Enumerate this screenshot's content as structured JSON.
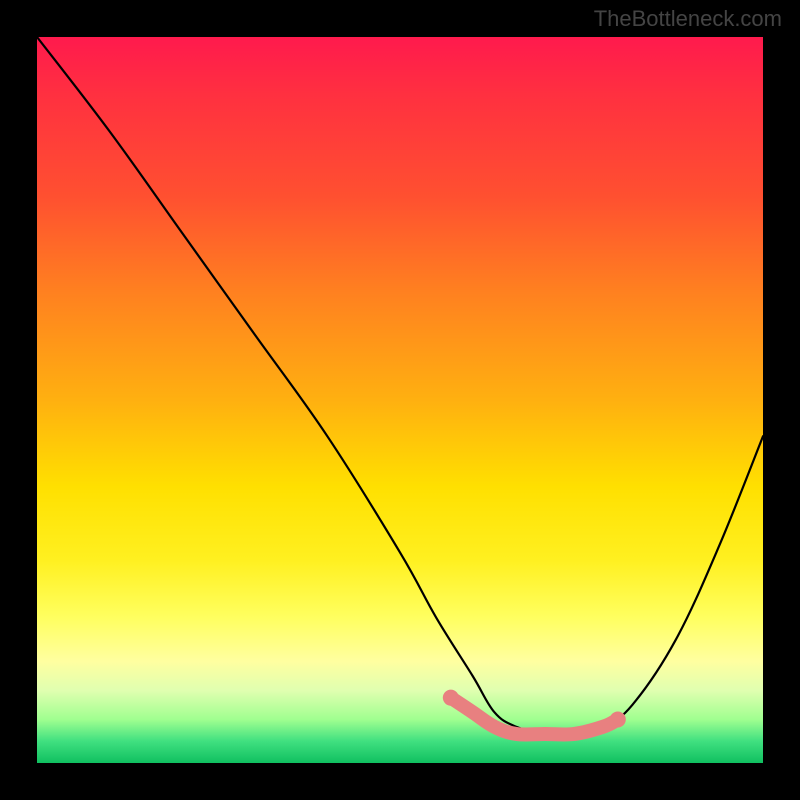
{
  "watermark": "TheBottleneck.com",
  "chart_data": {
    "type": "line",
    "title": "",
    "xlabel": "",
    "ylabel": "",
    "xlim": [
      0,
      100
    ],
    "ylim": [
      0,
      100
    ],
    "series": [
      {
        "name": "bottleneck-curve",
        "x": [
          0,
          10,
          20,
          30,
          40,
          50,
          55,
          60,
          63,
          66,
          70,
          74,
          78,
          82,
          88,
          94,
          100
        ],
        "y": [
          100,
          87,
          73,
          59,
          45,
          29,
          20,
          12,
          7,
          5,
          4,
          4,
          5,
          8,
          17,
          30,
          45
        ]
      }
    ],
    "highlight": {
      "name": "optimal-range",
      "x": [
        57,
        60,
        63,
        66,
        70,
        74,
        78,
        80
      ],
      "y": [
        9,
        7,
        5,
        4,
        4,
        4,
        5,
        6
      ]
    },
    "gradient_stops": [
      {
        "pos": 0,
        "color": "#ff1a4d"
      },
      {
        "pos": 100,
        "color": "#10c060"
      }
    ]
  }
}
